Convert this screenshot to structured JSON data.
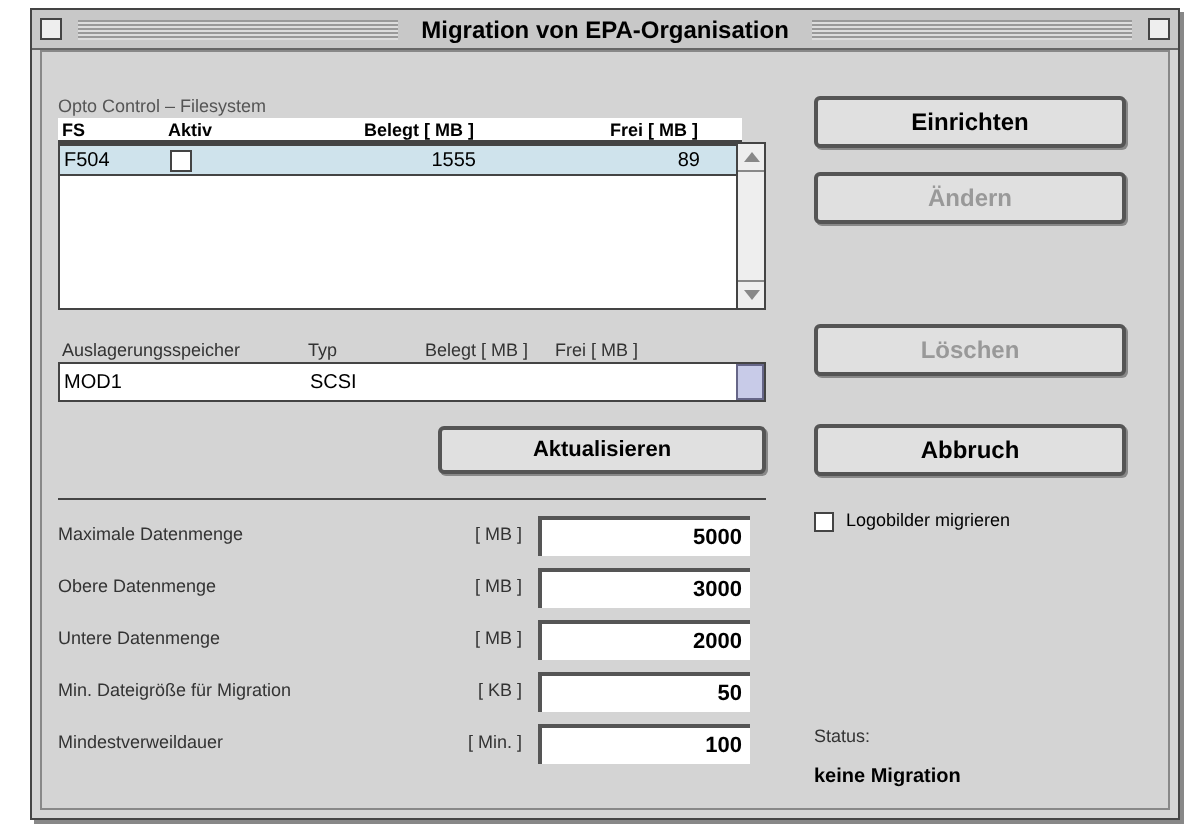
{
  "window": {
    "title": "Migration von EPA-Organisation"
  },
  "filesystems": {
    "label": "Opto Control – Filesystem",
    "columns": [
      "FS",
      "Aktiv",
      "Belegt [ MB ]",
      "Frei [ MB ]"
    ],
    "rows": [
      {
        "fs": "F504",
        "active": false,
        "used": "1555",
        "free": "89",
        "selected": true
      }
    ]
  },
  "storage": {
    "columns": [
      "Auslagerungsspeicher",
      "Typ",
      "Belegt [ MB ]",
      "Frei [ MB ]"
    ],
    "row": [
      "MOD1",
      "SCSI"
    ]
  },
  "refresh_button": "Aktualisieren",
  "settings": [
    {
      "label": "Maximale Datenmenge",
      "unit": "[ MB ]",
      "value": "5000"
    },
    {
      "label": "Obere Datenmenge",
      "unit": "[ MB ]",
      "value": "3000"
    },
    {
      "label": "Untere Datenmenge",
      "unit": "[ MB ]",
      "value": "2000"
    },
    {
      "label": "Min. Dateigröße für Migration",
      "unit": "[ KB ]",
      "value": "50"
    },
    {
      "label": "Mindestverweildauer",
      "unit": "[ Min. ]",
      "value": "100"
    }
  ],
  "buttons": [
    {
      "label": "Einrichten",
      "disabled": false
    },
    {
      "label": "Ändern",
      "disabled": true
    },
    {
      "label": "Löschen",
      "disabled": true
    },
    {
      "label": "Abbruch",
      "disabled": false
    }
  ],
  "option": {
    "label": "Logobilder migrieren",
    "checked": false
  },
  "status": {
    "label": "Status:",
    "value": "keine Migration"
  }
}
